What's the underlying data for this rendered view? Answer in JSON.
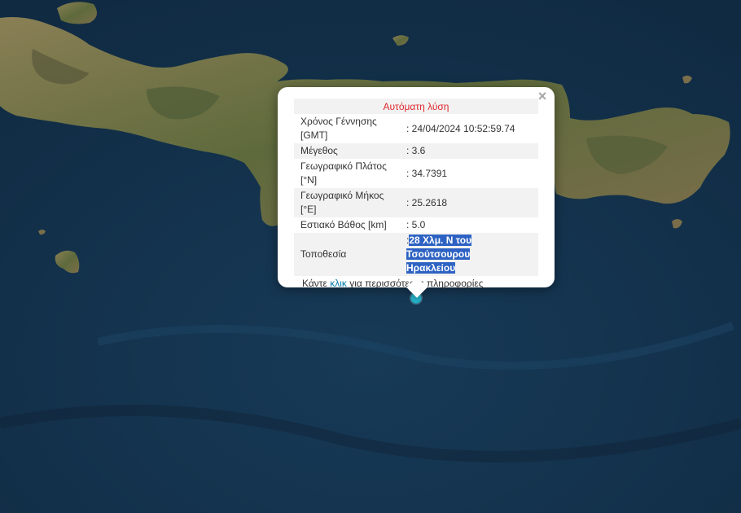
{
  "popup": {
    "title": "Αυτόματη λύση",
    "close_glyph": "×",
    "rows": [
      {
        "label_line1": "Χρόνος Γέννησης",
        "label_line2": "[GMT]",
        "value": ": 24/04/2024 10:52:59.74"
      },
      {
        "label": "Μέγεθος",
        "value": ": 3.6"
      },
      {
        "label_line1": "Γεωγραφικό Πλάτος",
        "label_line2": "[°N]",
        "value": ": 34.7391"
      },
      {
        "label_line1": "Γεωγραφικό Μήκος",
        "label_line2": "[°E]",
        "value": ": 25.2618"
      },
      {
        "label": "Εστιακό Βάθος [km]",
        "value": ": 5.0"
      },
      {
        "label": "Τοποθεσία",
        "value_prefix": ":",
        "value_line1": "28 Χλμ. N του Τσούτσουρου",
        "value_line2": "Ηρακλείου"
      }
    ],
    "more_before": "Κάντε ",
    "more_link": "κλικ",
    "more_after": " για περισσότερες πληροφορίες"
  },
  "marker": {
    "icon": "epicenter-marker-icon",
    "color": "#27b5cc"
  },
  "map": {
    "sea_color": "#14324d",
    "land_color": "#6b6a44",
    "highlight_color": "#2d62c3"
  }
}
